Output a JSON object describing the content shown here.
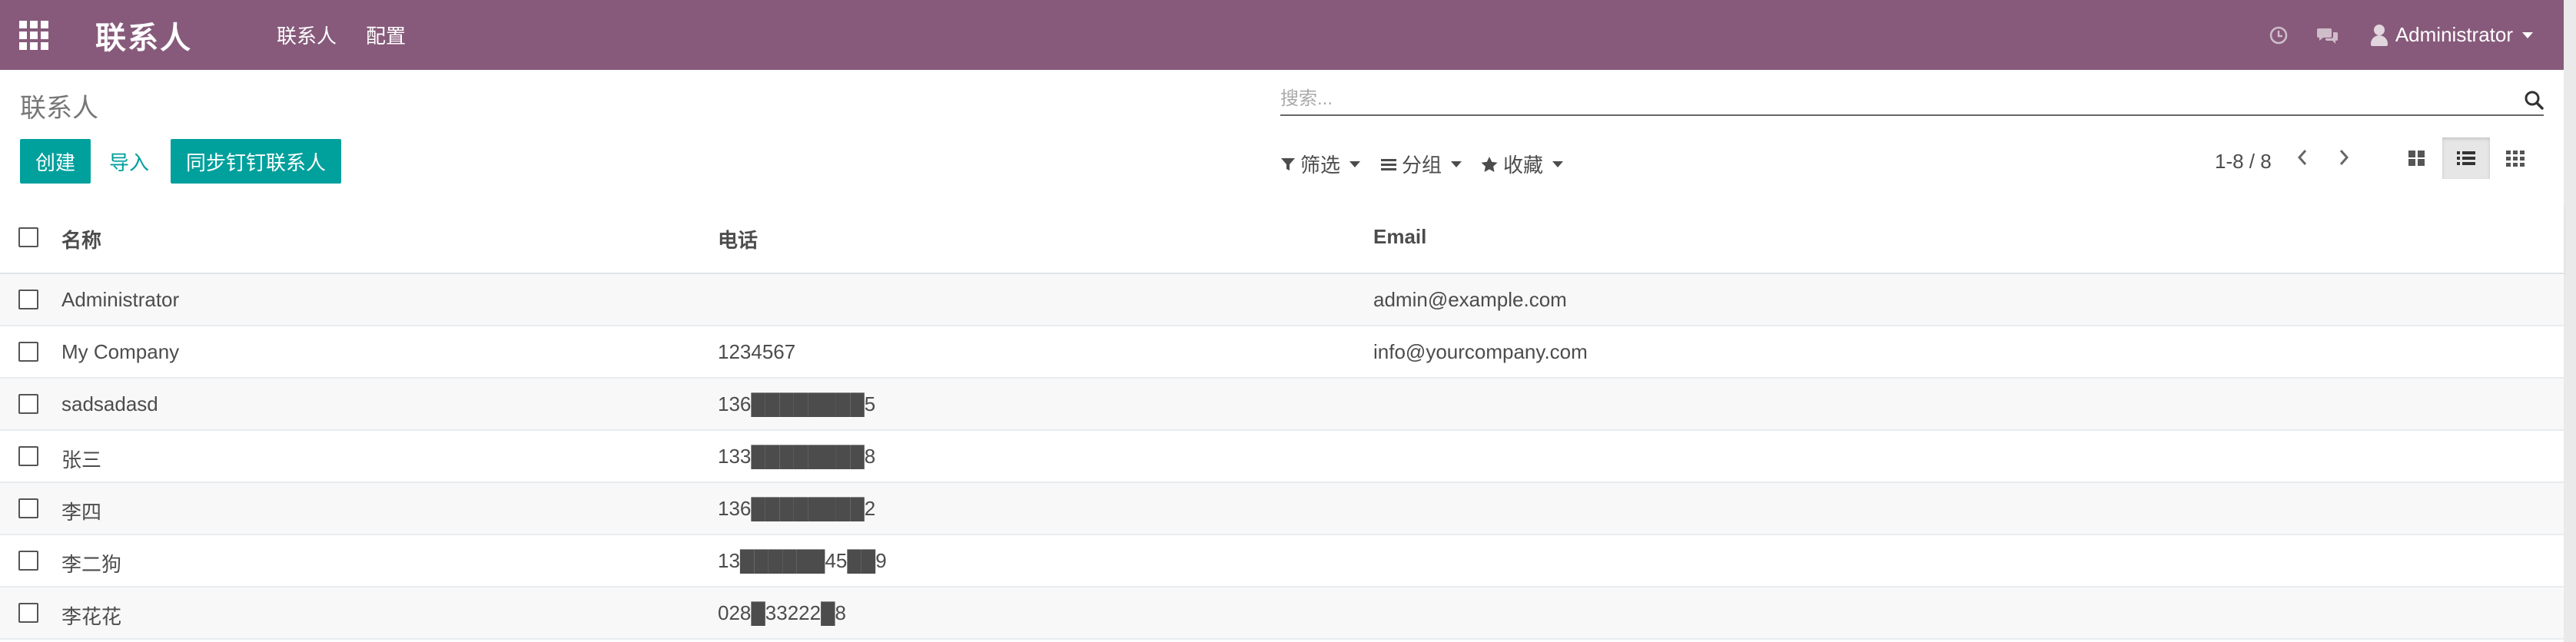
{
  "navbar": {
    "app_title": "联系人",
    "menu": [
      "联系人",
      "配置"
    ],
    "user_name": "Administrator"
  },
  "control_panel": {
    "breadcrumb": "联系人",
    "search_placeholder": "搜索...",
    "create_label": "创建",
    "import_label": "导入",
    "sync_label": "同步钉钉联系人",
    "filter_label": "筛选",
    "group_label": "分组",
    "favorites_label": "收藏",
    "pager": "1-8 / 8"
  },
  "table": {
    "columns": [
      "名称",
      "电话",
      "Email"
    ],
    "rows": [
      {
        "name": "Administrator",
        "phone": "",
        "email": "admin@example.com"
      },
      {
        "name": "My Company",
        "phone": "1234567",
        "email": "info@yourcompany.com"
      },
      {
        "name": "sadsadasd",
        "phone": "136████████5",
        "email": ""
      },
      {
        "name": "张三",
        "phone": "133████████8",
        "email": ""
      },
      {
        "name": "李四",
        "phone": "136████████2",
        "email": ""
      },
      {
        "name": "李二狗",
        "phone": "13██████45██9",
        "email": ""
      },
      {
        "name": "李花花",
        "phone": "028█33222█8",
        "email": ""
      }
    ]
  },
  "colors": {
    "navbar": "#875a7b",
    "primary": "#00a09d"
  }
}
